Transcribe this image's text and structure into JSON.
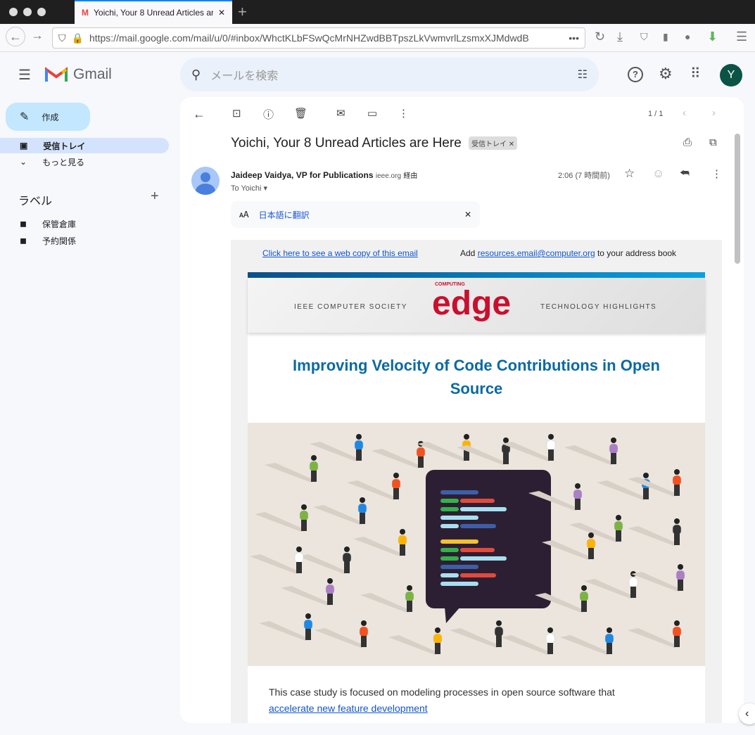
{
  "browser": {
    "tab_title": "Yoichi, Your 8 Unread Articles are Here",
    "url": "https://mail.google.com/mail/u/0/#inbox/WhctKLbFSwQcMrNHZwdBBTpszLkVwmvrlLzsmxXJMdwdB"
  },
  "gmail": {
    "logo": "Gmail",
    "search_placeholder": "メールを検索",
    "avatar_letter": "Y",
    "compose": "作成",
    "nav": [
      {
        "label": "受信トレイ"
      },
      {
        "label": "もっと見る"
      }
    ],
    "labels_title": "ラベル",
    "labels": [
      {
        "label": "保管倉庫"
      },
      {
        "label": "予約関係"
      }
    ]
  },
  "message": {
    "pagination": "1 / 1",
    "subject": "Yoichi, Your 8 Unread Articles are Here",
    "label_chip": "受信トレイ",
    "sender": "Jaideep Vaidya, VP for Publications",
    "via_domain": "ieee.org",
    "via": "経由",
    "to": "To Yoichi",
    "time": "2:06 (7 時間前)",
    "translate": "日本語に翻訳"
  },
  "body": {
    "web_copy": "Click here to see a web copy of this email",
    "add": "Add",
    "address": "resources.email@computer.org",
    "address_suffix": "to your address book",
    "banner_left": "IEEE COMPUTER SOCIETY",
    "banner_brand_small": "COMPUTING",
    "banner_brand": "edge",
    "banner_right": "TECHNOLOGY HIGHLIGHTS",
    "headline": "Improving Velocity of Code Contributions in Open Source",
    "text": "This case study is focused on modeling processes in open source software that",
    "link": "accelerate new feature development"
  },
  "colors": {
    "accent": "#0b6aa2",
    "brand": "#c8102e"
  }
}
